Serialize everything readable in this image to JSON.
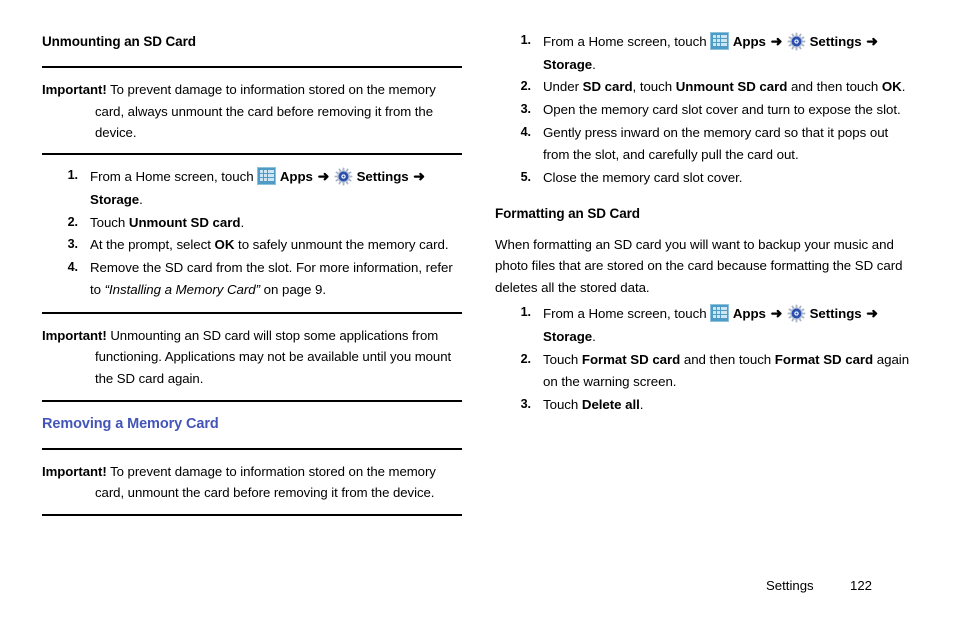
{
  "icons": {
    "apps": "apps-grid-icon",
    "settings": "settings-gear-icon",
    "arrow": "➜"
  },
  "colors": {
    "blue_heading": "#4455b8",
    "apps_icon_blue": "#4e9cc6",
    "gear_blue": "#2b4fae",
    "rule": "#000000"
  },
  "left_column": {
    "heading": "Unmounting an SD Card",
    "important_1": {
      "label": "Important!",
      "text": "To prevent damage to information stored on the memory card, always unmount the card before removing it from the device."
    },
    "steps": [
      {
        "num": "1.",
        "parts": [
          {
            "t": "From a Home screen, touch ",
            "style": "normal"
          },
          {
            "t": "apps-icon",
            "style": "icon"
          },
          {
            "t": "Apps",
            "style": "bold"
          },
          {
            "t": "arrow",
            "style": "icon"
          },
          {
            "t": "settings-icon",
            "style": "icon"
          },
          {
            "t": "Settings",
            "style": "bold"
          },
          {
            "t": "arrow",
            "style": "icon"
          },
          {
            "t": "Storage",
            "style": "bold"
          },
          {
            "t": ".",
            "style": "normal"
          }
        ]
      },
      {
        "num": "2.",
        "parts": [
          {
            "t": "Touch ",
            "style": "normal"
          },
          {
            "t": "Unmount SD card",
            "style": "bold"
          },
          {
            "t": ".",
            "style": "normal"
          }
        ]
      },
      {
        "num": "3.",
        "parts": [
          {
            "t": "At the prompt, select ",
            "style": "normal"
          },
          {
            "t": "OK",
            "style": "bold"
          },
          {
            "t": " to safely unmount the memory card.",
            "style": "normal"
          }
        ]
      },
      {
        "num": "4.",
        "parts": [
          {
            "t": "Remove the SD card from the slot. For more information, refer to ",
            "style": "normal"
          },
          {
            "t": "“Installing a Memory Card”",
            "style": "italic"
          },
          {
            "t": " on page 9.",
            "style": "normal"
          }
        ]
      }
    ],
    "important_2": {
      "label": "Important!",
      "text": "Unmounting an SD card will stop some applications from functioning. Applications may not be available until you mount the SD card again."
    },
    "heading_2": "Removing a Memory Card",
    "important_3": {
      "label": "Important!",
      "text": "To prevent damage to information stored on the memory card, unmount the card before removing it from the device."
    }
  },
  "right_column": {
    "steps_top": [
      {
        "num": "1.",
        "parts": [
          {
            "t": "From a Home screen, touch ",
            "style": "normal"
          },
          {
            "t": "apps-icon",
            "style": "icon"
          },
          {
            "t": "Apps",
            "style": "bold"
          },
          {
            "t": "arrow",
            "style": "icon"
          },
          {
            "t": "settings-icon",
            "style": "icon"
          },
          {
            "t": "Settings",
            "style": "bold"
          },
          {
            "t": "arrow",
            "style": "icon"
          },
          {
            "t": "Storage",
            "style": "bold"
          },
          {
            "t": ".",
            "style": "normal"
          }
        ]
      },
      {
        "num": "2.",
        "parts": [
          {
            "t": "Under ",
            "style": "normal"
          },
          {
            "t": "SD card",
            "style": "bold"
          },
          {
            "t": ", touch ",
            "style": "normal"
          },
          {
            "t": "Unmount SD card",
            "style": "bold"
          },
          {
            "t": " and then touch ",
            "style": "normal"
          },
          {
            "t": "OK",
            "style": "bold"
          },
          {
            "t": ".",
            "style": "normal"
          }
        ]
      },
      {
        "num": "3.",
        "parts": [
          {
            "t": "Open the memory card slot cover and turn to expose the slot.",
            "style": "normal"
          }
        ]
      },
      {
        "num": "4.",
        "parts": [
          {
            "t": "Gently press inward on the memory card so that it pops out from the slot, and carefully pull the card out.",
            "style": "normal"
          }
        ]
      },
      {
        "num": "5.",
        "parts": [
          {
            "t": "Close the memory card slot cover.",
            "style": "normal"
          }
        ]
      }
    ],
    "heading": "Formatting an SD Card",
    "intro": "When formatting an SD card you will want to backup your music and photo files that are stored on the card because formatting the SD card deletes all the stored data.",
    "steps_bottom": [
      {
        "num": "1.",
        "parts": [
          {
            "t": "From a Home screen, touch ",
            "style": "normal"
          },
          {
            "t": "apps-icon",
            "style": "icon"
          },
          {
            "t": "Apps",
            "style": "bold"
          },
          {
            "t": "arrow",
            "style": "icon"
          },
          {
            "t": "settings-icon",
            "style": "icon"
          },
          {
            "t": "Settings",
            "style": "bold"
          },
          {
            "t": "arrow",
            "style": "icon"
          },
          {
            "t": "Storage",
            "style": "bold"
          },
          {
            "t": ".",
            "style": "normal"
          }
        ]
      },
      {
        "num": "2.",
        "parts": [
          {
            "t": "Touch ",
            "style": "normal"
          },
          {
            "t": "Format SD card",
            "style": "bold"
          },
          {
            "t": " and then touch ",
            "style": "normal"
          },
          {
            "t": "Format SD card",
            "style": "bold"
          },
          {
            "t": " again on the warning screen.",
            "style": "normal"
          }
        ]
      },
      {
        "num": "3.",
        "parts": [
          {
            "t": "Touch ",
            "style": "normal"
          },
          {
            "t": "Delete all",
            "style": "bold"
          },
          {
            "t": ".",
            "style": "normal"
          }
        ]
      }
    ]
  },
  "footer": {
    "section": "Settings",
    "page_number": "122"
  }
}
